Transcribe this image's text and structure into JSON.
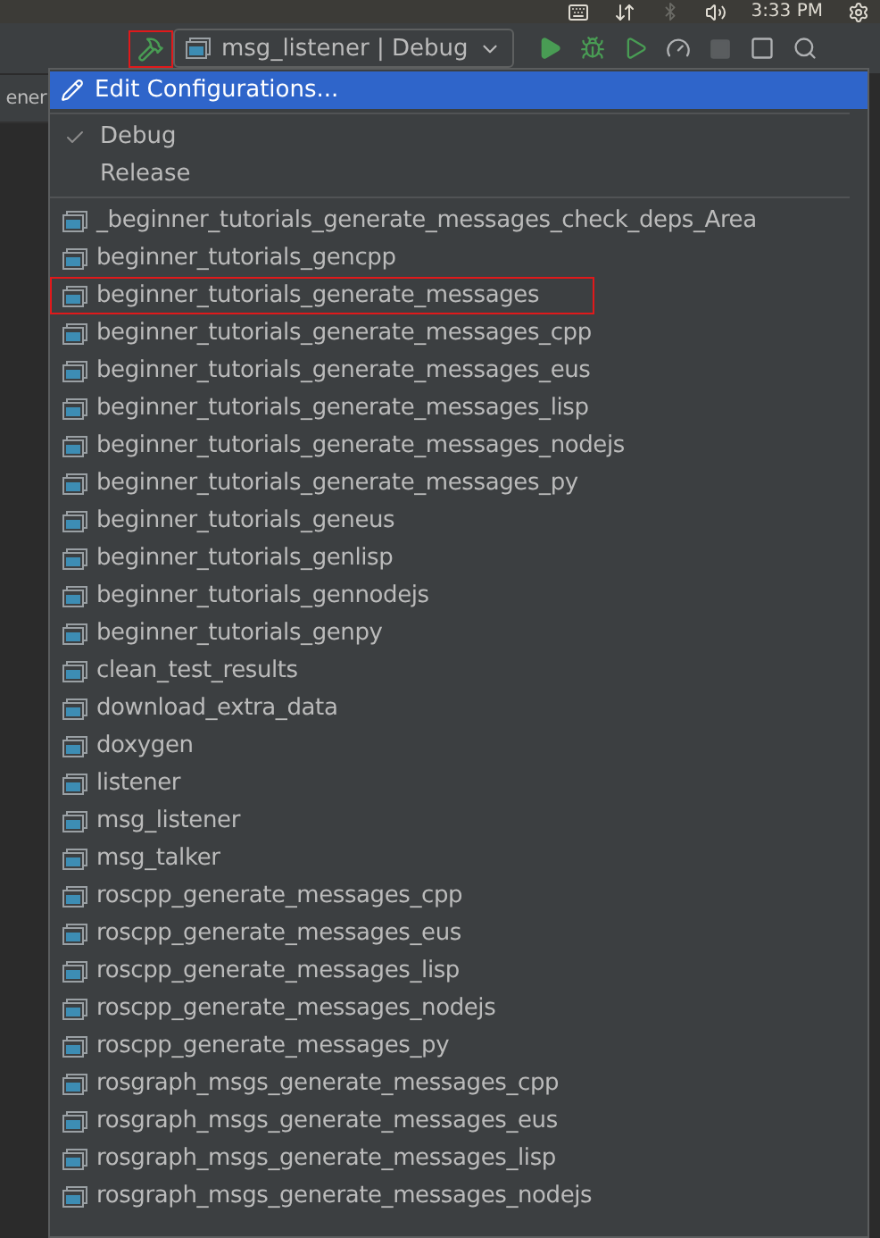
{
  "system_bar": {
    "time": "3:33 PM"
  },
  "toolbar": {
    "build_highlighted": true,
    "configuration": "msg_listener | Debug"
  },
  "editor_tab": {
    "label": "ener"
  },
  "menu": {
    "edit_item": {
      "label": "Edit Configurations...",
      "selected": true
    },
    "build_types": [
      {
        "label": "Debug",
        "checked": true
      },
      {
        "label": "Release",
        "checked": false
      }
    ],
    "targets": [
      {
        "label": "_beginner_tutorials_generate_messages_check_deps_Area",
        "highlighted": false
      },
      {
        "label": "beginner_tutorials_gencpp",
        "highlighted": false
      },
      {
        "label": "beginner_tutorials_generate_messages",
        "highlighted": true
      },
      {
        "label": "beginner_tutorials_generate_messages_cpp",
        "highlighted": false
      },
      {
        "label": "beginner_tutorials_generate_messages_eus",
        "highlighted": false
      },
      {
        "label": "beginner_tutorials_generate_messages_lisp",
        "highlighted": false
      },
      {
        "label": "beginner_tutorials_generate_messages_nodejs",
        "highlighted": false
      },
      {
        "label": "beginner_tutorials_generate_messages_py",
        "highlighted": false
      },
      {
        "label": "beginner_tutorials_geneus",
        "highlighted": false
      },
      {
        "label": "beginner_tutorials_genlisp",
        "highlighted": false
      },
      {
        "label": "beginner_tutorials_gennodejs",
        "highlighted": false
      },
      {
        "label": "beginner_tutorials_genpy",
        "highlighted": false
      },
      {
        "label": "clean_test_results",
        "highlighted": false
      },
      {
        "label": "download_extra_data",
        "highlighted": false
      },
      {
        "label": "doxygen",
        "highlighted": false
      },
      {
        "label": "listener",
        "highlighted": false
      },
      {
        "label": "msg_listener",
        "highlighted": false
      },
      {
        "label": "msg_talker",
        "highlighted": false
      },
      {
        "label": "roscpp_generate_messages_cpp",
        "highlighted": false
      },
      {
        "label": "roscpp_generate_messages_eus",
        "highlighted": false
      },
      {
        "label": "roscpp_generate_messages_lisp",
        "highlighted": false
      },
      {
        "label": "roscpp_generate_messages_nodejs",
        "highlighted": false
      },
      {
        "label": "roscpp_generate_messages_py",
        "highlighted": false
      },
      {
        "label": "rosgraph_msgs_generate_messages_cpp",
        "highlighted": false
      },
      {
        "label": "rosgraph_msgs_generate_messages_eus",
        "highlighted": false
      },
      {
        "label": "rosgraph_msgs_generate_messages_lisp",
        "highlighted": false
      },
      {
        "label": "rosgraph_msgs_generate_messages_nodejs",
        "highlighted": false
      }
    ]
  }
}
